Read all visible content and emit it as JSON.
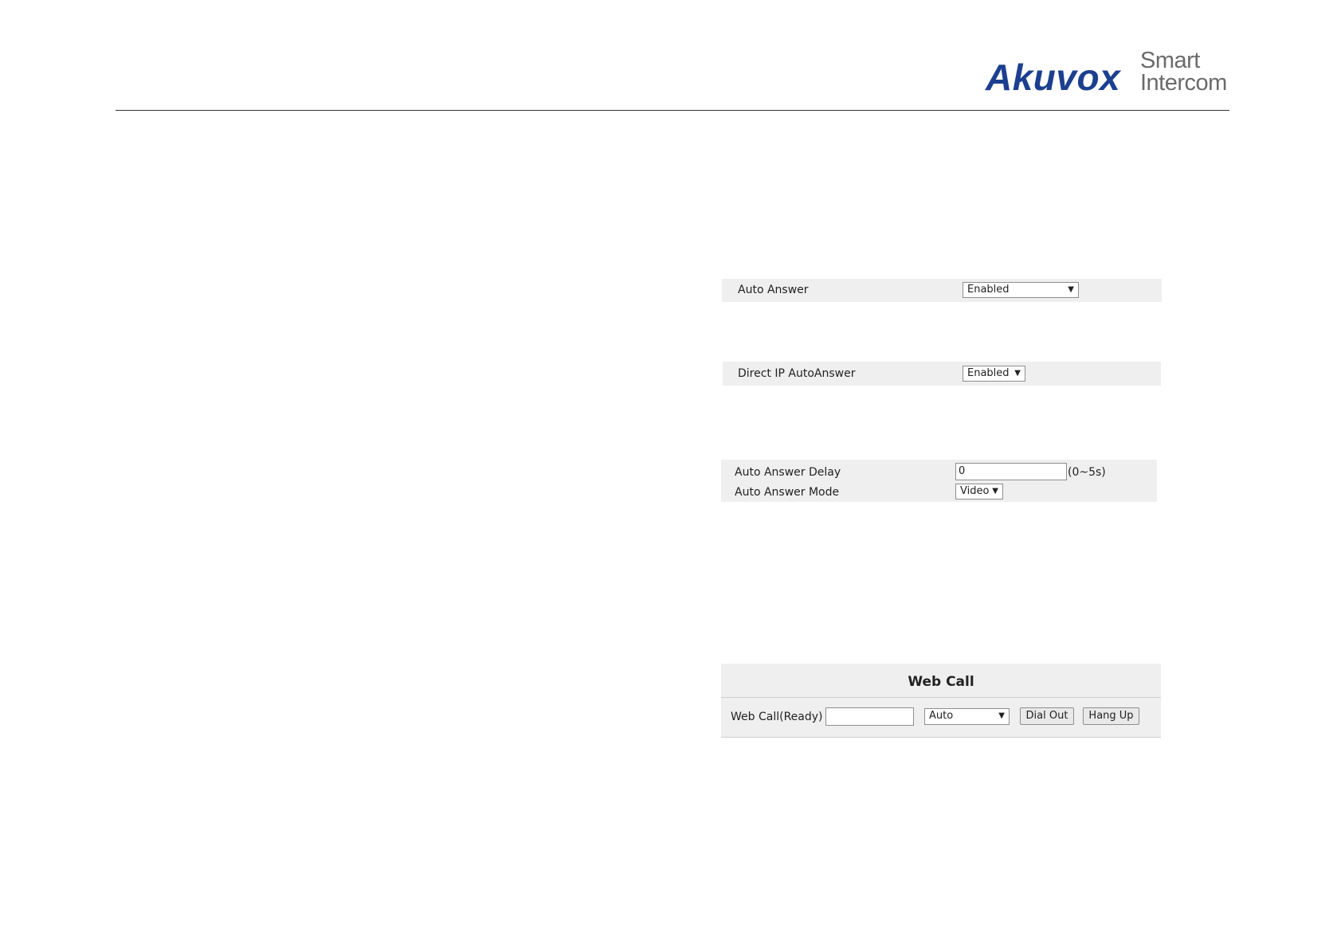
{
  "brand": {
    "name": "Akuvox",
    "tagline_line1": "Smart",
    "tagline_line2": "Intercom",
    "color": "#1c3f8f"
  },
  "auto_answer": {
    "label": "Auto Answer",
    "value": "Enabled"
  },
  "direct_ip": {
    "label": "Direct IP AutoAnswer",
    "value": "Enabled"
  },
  "auto_answer_settings": {
    "delay_label": "Auto Answer Delay",
    "delay_value": "0",
    "delay_hint": "(0~5s)",
    "mode_label": "Auto Answer Mode",
    "mode_value": "Video"
  },
  "web_call": {
    "title": "Web Call",
    "label": "Web Call(Ready)",
    "number_value": "",
    "mode_value": "Auto",
    "dial_out": "Dial Out",
    "hang_up": "Hang Up"
  },
  "icons": {
    "dropdown": "dropdown-arrow-icon"
  },
  "colors": {
    "panel_bg": "#efefef",
    "rule": "#333333",
    "tagline": "#6b6b6b"
  }
}
